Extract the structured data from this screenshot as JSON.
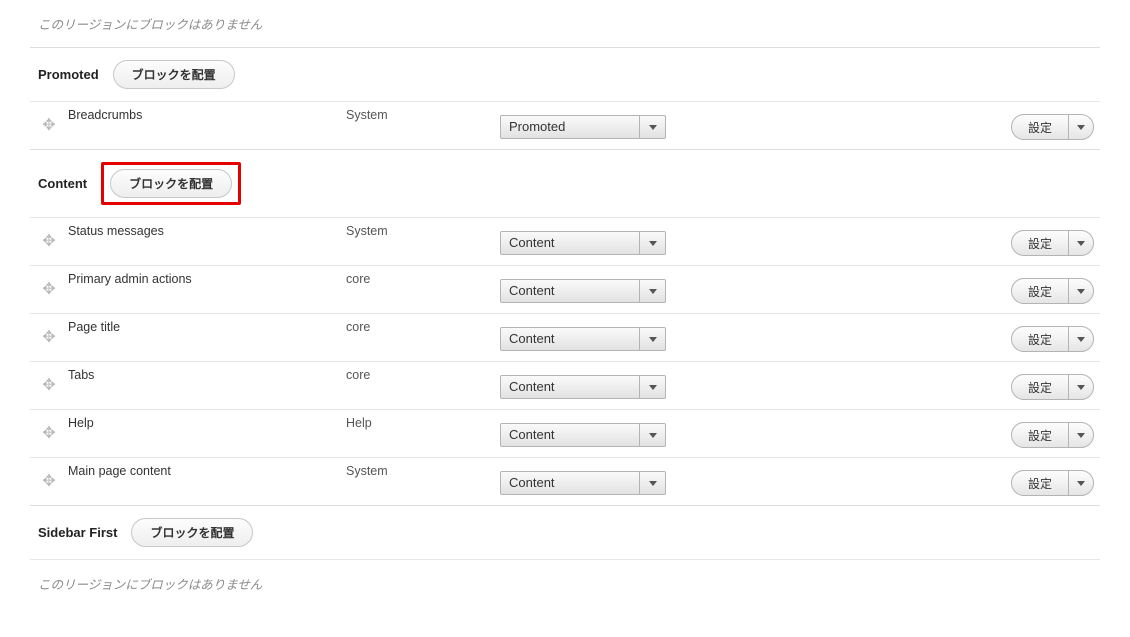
{
  "labels": {
    "place_block": "ブロックを配置",
    "settings": "設定",
    "empty_region": "このリージョンにブロックはありません"
  },
  "top_region": {
    "empty": true
  },
  "regions": [
    {
      "name": "Promoted",
      "highlighted": false,
      "blocks": [
        {
          "block": "Breadcrumbs",
          "category": "System",
          "region_value": "Promoted"
        }
      ]
    },
    {
      "name": "Content",
      "highlighted": true,
      "blocks": [
        {
          "block": "Status messages",
          "category": "System",
          "region_value": "Content"
        },
        {
          "block": "Primary admin actions",
          "category": "core",
          "region_value": "Content"
        },
        {
          "block": "Page title",
          "category": "core",
          "region_value": "Content"
        },
        {
          "block": "Tabs",
          "category": "core",
          "region_value": "Content"
        },
        {
          "block": "Help",
          "category": "Help",
          "region_value": "Content"
        },
        {
          "block": "Main page content",
          "category": "System",
          "region_value": "Content"
        }
      ]
    },
    {
      "name": "Sidebar First",
      "highlighted": false,
      "blocks": [],
      "empty": true
    }
  ]
}
